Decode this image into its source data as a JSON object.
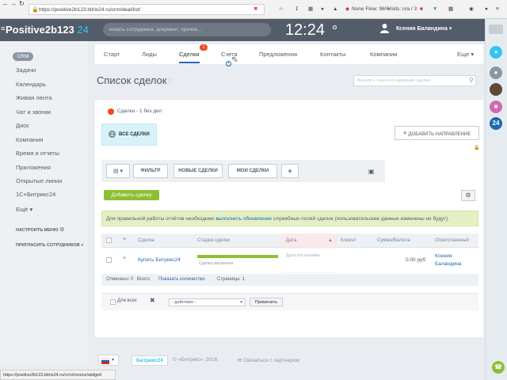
{
  "browser": {
    "url": "https://positive2b123.bitrix24.ru/crm/deal/list/",
    "ext_none_flow": "None Flow: 96%",
    "ext_visits": "Visits: n/a / 3",
    "status_url": "https://positive2b123.bitrix24.ru/crm/invoice/widget/"
  },
  "header": {
    "logo_name": "Positive2b123",
    "logo_num": "24",
    "search_placeholder": "искать сотрудника, документ, прочее...",
    "clock": "12:24",
    "user_name": "Ксения Баландина"
  },
  "sidebar": {
    "crm_label": "CRM",
    "items": [
      "Задачи",
      "Календарь",
      "Живая лента",
      "Чат и звонки",
      "Диск",
      "Компания",
      "Время и отчеты",
      "Приложения",
      "Открытые линии",
      "1С+Битрикс24",
      "Ещё"
    ],
    "settings_menu": "НАСТРОИТЬ МЕНЮ",
    "invite": "ПРИГЛАСИТЬ СОТРУДНИКОВ"
  },
  "tabs": {
    "items": [
      "Старт",
      "Лиды",
      "Сделки",
      "Счета",
      "Предложения",
      "Контакты",
      "Компании"
    ],
    "badge": "1",
    "more": "Еще"
  },
  "page": {
    "title": "Список сделок",
    "filter_placeholder": "Фильтр + поиск по названию сделки..."
  },
  "deals_summary": "Сделки - 1 без дел",
  "all_deals": "ВСЕ СДЕЛКИ",
  "add_direction": "ДОБАВИТЬ НАПРАВЛЕНИЕ",
  "filterbar": {
    "filter": "ФИЛЬТР",
    "new_deals": "НОВЫЕ СДЕЛКИ",
    "my_deals": "МОИ СДЕЛКИ",
    "plus": "+"
  },
  "add_deal": "Добавить сделку",
  "notice": {
    "prefix": "Для правильной работы отчётов необходимо ",
    "link": "выполнить обновление",
    "suffix": " служебных полей сделок (пользовательские данные изменены не будут)."
  },
  "table": {
    "headers": [
      "Сделка",
      "Стадия сделки",
      "Дата",
      "Клиент",
      "Сумма/Валюта",
      "Ответственный"
    ],
    "row": {
      "deal": "Купить Битрикс24",
      "stage": "Сделка заключена",
      "date": "Дата постановки",
      "amount": "0.00 руб",
      "responsible_first": "Ксения",
      "responsible_last": "Баландина"
    },
    "footer": {
      "marked": "Отмечено: 0",
      "total_prefix": "Всего:",
      "total_link": "Показать количество",
      "pages": "Страницы: 1"
    }
  },
  "actions": {
    "for_all": "Для всех",
    "select": "- действия -",
    "apply": "Применить"
  },
  "footer": {
    "b24": "Битрикс24",
    "copyright": "© «Битрикс», 2016",
    "partner": "Связаться с партнером"
  },
  "rstrip": {
    "badge24": "24"
  }
}
